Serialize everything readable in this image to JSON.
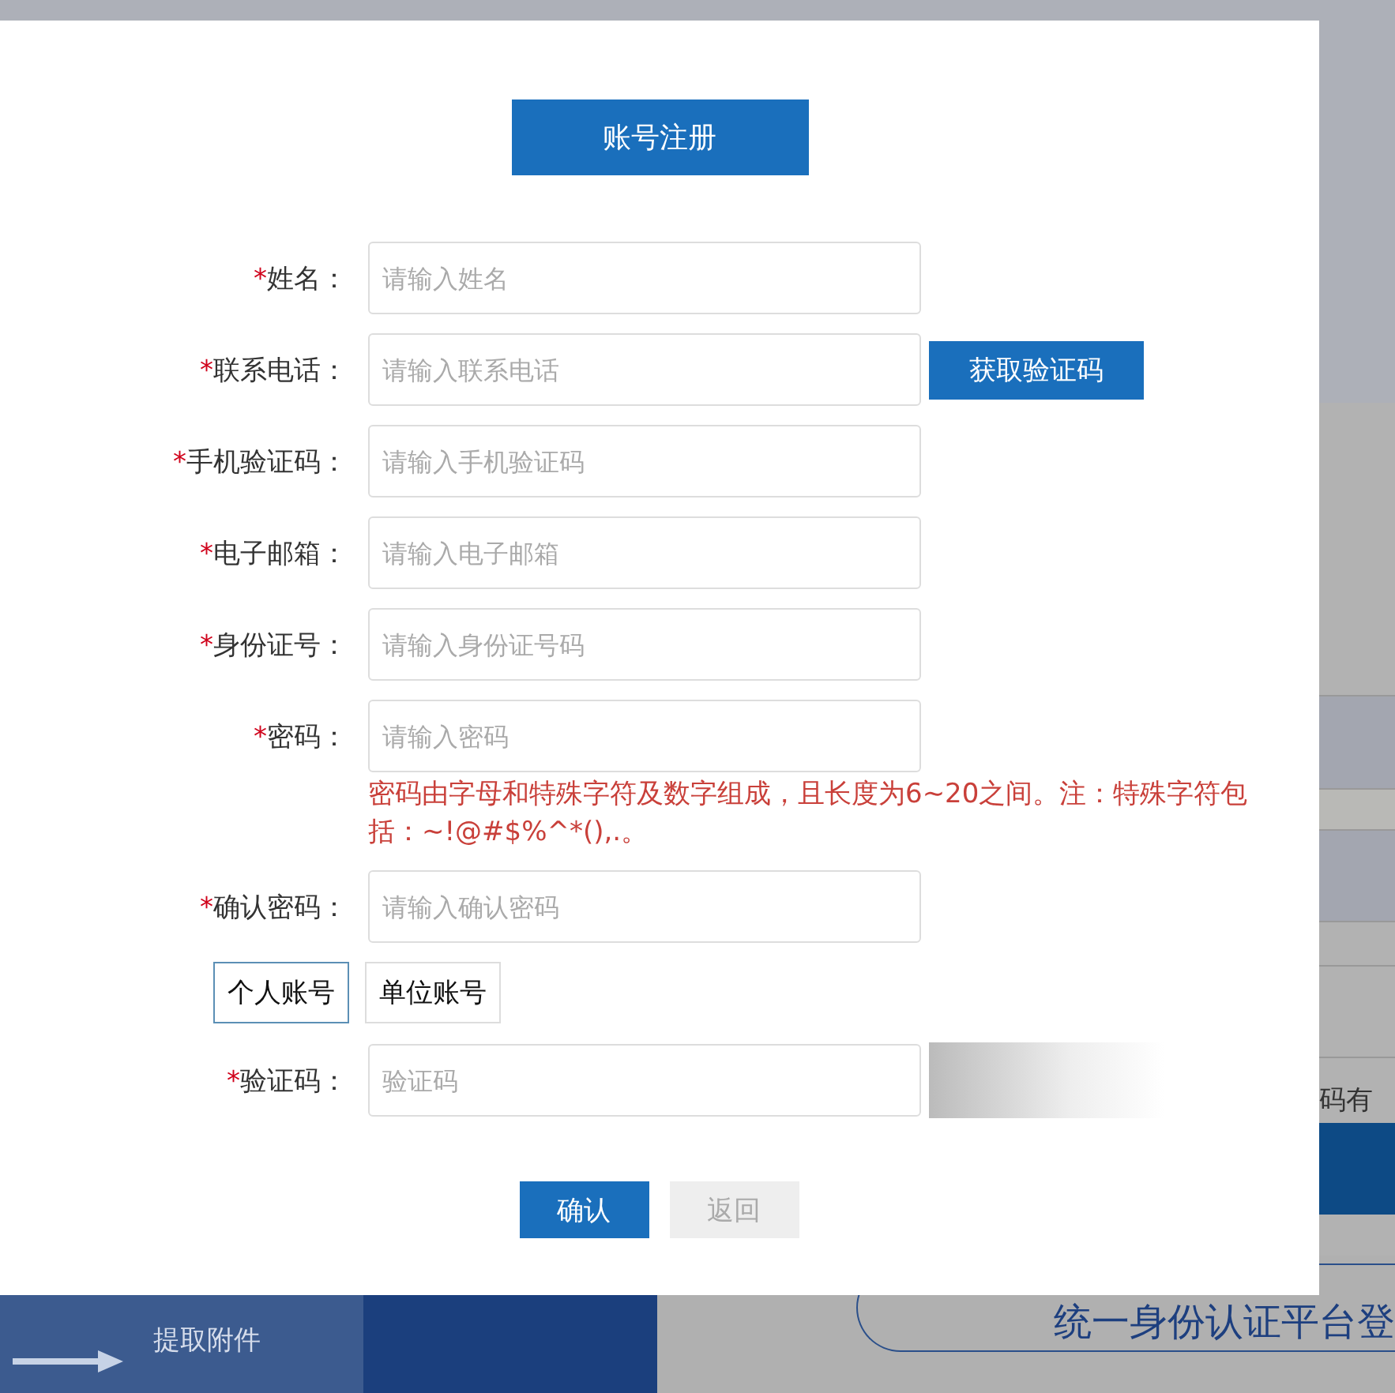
{
  "dialog": {
    "title": "账号注册",
    "fields": [
      {
        "marker": "*",
        "label": "姓名：",
        "placeholder": "请输入姓名"
      },
      {
        "marker": "*",
        "label": "联系电话：",
        "placeholder": "请输入联系电话",
        "action": "获取验证码"
      },
      {
        "marker": "*",
        "label": "手机验证码：",
        "placeholder": "请输入手机验证码"
      },
      {
        "marker": "*",
        "label": "电子邮箱：",
        "placeholder": "请输入电子邮箱"
      },
      {
        "marker": "*",
        "label": "身份证号：",
        "placeholder": "请输入身份证号码"
      },
      {
        "marker": "*",
        "label": "密码：",
        "placeholder": "请输入密码",
        "hint": "密码由字母和特殊字符及数字组成，且长度为6~20之间。注：特殊字符包括：~!@#$%^*(),.。"
      },
      {
        "marker": "*",
        "label": "确认密码：",
        "placeholder": "请输入确认密码"
      }
    ],
    "account_types": [
      {
        "label": "个人账号",
        "selected": true
      },
      {
        "label": "单位账号",
        "selected": false
      }
    ],
    "captcha": {
      "marker": "*",
      "label": "验证码：",
      "placeholder": "验证码"
    },
    "buttons": [
      {
        "label": "确认",
        "kind": "primary"
      },
      {
        "label": "返回",
        "kind": "secondary"
      }
    ]
  },
  "background": {
    "side_text": "码有",
    "attachment_link": "提取附件",
    "login_button": "统一身份认证平台登"
  }
}
